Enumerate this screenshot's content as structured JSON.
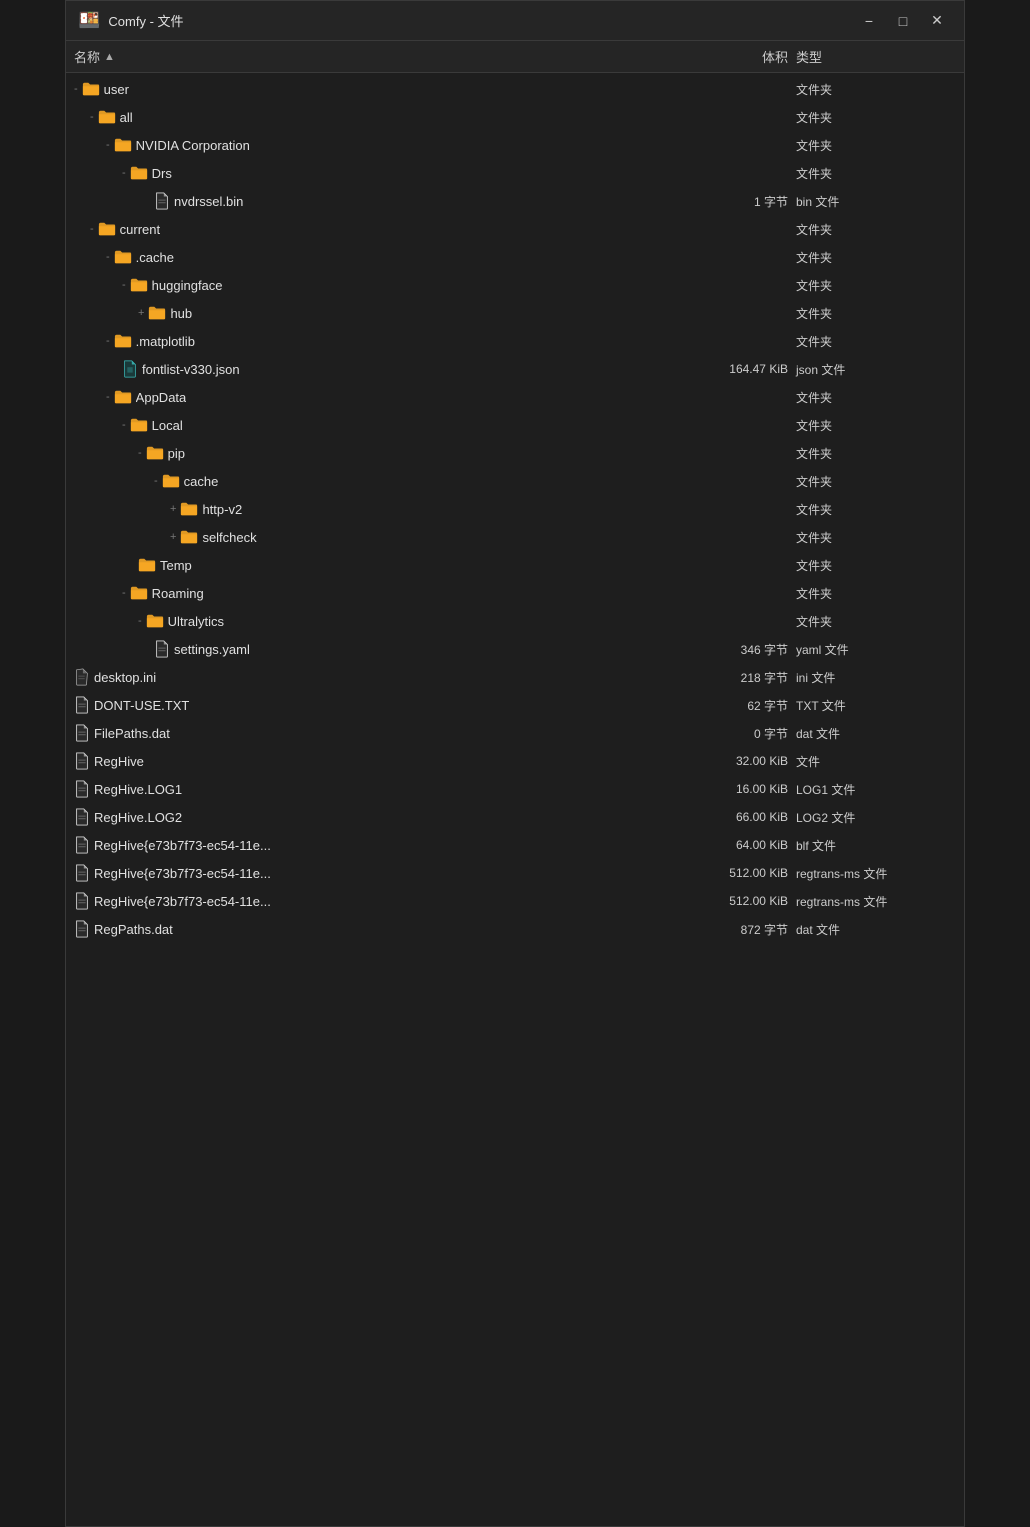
{
  "titlebar": {
    "icon": "🍱",
    "title": "Comfy - 文件",
    "minimize_label": "−",
    "maximize_label": "□",
    "close_label": "✕"
  },
  "header": {
    "name_label": "名称",
    "size_label": "体积",
    "type_label": "类型"
  },
  "files": [
    {
      "id": 1,
      "indent": 0,
      "prefix": "-",
      "type": "folder",
      "name": "user",
      "size": "",
      "filetype": "文件夹",
      "expand": ""
    },
    {
      "id": 2,
      "indent": 1,
      "prefix": "-",
      "type": "folder",
      "name": "all",
      "size": "",
      "filetype": "文件夹",
      "expand": ""
    },
    {
      "id": 3,
      "indent": 2,
      "prefix": "-",
      "type": "folder",
      "name": "NVIDIA Corporation",
      "size": "",
      "filetype": "文件夹",
      "expand": ""
    },
    {
      "id": 4,
      "indent": 3,
      "prefix": "-",
      "type": "folder",
      "name": "Drs",
      "size": "",
      "filetype": "文件夹",
      "expand": ""
    },
    {
      "id": 5,
      "indent": 5,
      "prefix": "",
      "type": "file-white",
      "name": "nvdrssel.bin",
      "size": "1 字节",
      "filetype": "bin 文件",
      "expand": ""
    },
    {
      "id": 6,
      "indent": 1,
      "prefix": "-",
      "type": "folder",
      "name": "current",
      "size": "",
      "filetype": "文件夹",
      "expand": ""
    },
    {
      "id": 7,
      "indent": 2,
      "prefix": "-",
      "type": "folder",
      "name": ".cache",
      "size": "",
      "filetype": "文件夹",
      "expand": ""
    },
    {
      "id": 8,
      "indent": 3,
      "prefix": "-",
      "type": "folder",
      "name": "huggingface",
      "size": "",
      "filetype": "文件夹",
      "expand": ""
    },
    {
      "id": 9,
      "indent": 4,
      "prefix": "+",
      "type": "folder",
      "name": "hub",
      "size": "",
      "filetype": "文件夹",
      "expand": ""
    },
    {
      "id": 10,
      "indent": 2,
      "prefix": "-",
      "type": "folder",
      "name": ".matplotlib",
      "size": "",
      "filetype": "文件夹",
      "expand": ""
    },
    {
      "id": 11,
      "indent": 3,
      "prefix": "",
      "type": "file-teal",
      "name": "fontlist-v330.json",
      "size": "164.47 KiB",
      "filetype": "json 文件",
      "expand": ""
    },
    {
      "id": 12,
      "indent": 2,
      "prefix": "-",
      "type": "folder",
      "name": "AppData",
      "size": "",
      "filetype": "文件夹",
      "expand": ""
    },
    {
      "id": 13,
      "indent": 3,
      "prefix": "-",
      "type": "folder",
      "name": "Local",
      "size": "",
      "filetype": "文件夹",
      "expand": ""
    },
    {
      "id": 14,
      "indent": 4,
      "prefix": "-",
      "type": "folder",
      "name": "pip",
      "size": "",
      "filetype": "文件夹",
      "expand": ""
    },
    {
      "id": 15,
      "indent": 5,
      "prefix": "-",
      "type": "folder",
      "name": "cache",
      "size": "",
      "filetype": "文件夹",
      "expand": ""
    },
    {
      "id": 16,
      "indent": 6,
      "prefix": "+",
      "type": "folder",
      "name": "http-v2",
      "size": "",
      "filetype": "文件夹",
      "expand": ""
    },
    {
      "id": 17,
      "indent": 6,
      "prefix": "+",
      "type": "folder",
      "name": "selfcheck",
      "size": "",
      "filetype": "文件夹",
      "expand": ""
    },
    {
      "id": 18,
      "indent": 4,
      "prefix": "",
      "type": "folder",
      "name": "Temp",
      "size": "",
      "filetype": "文件夹",
      "expand": ""
    },
    {
      "id": 19,
      "indent": 3,
      "prefix": "-",
      "type": "folder",
      "name": "Roaming",
      "size": "",
      "filetype": "文件夹",
      "expand": ""
    },
    {
      "id": 20,
      "indent": 4,
      "prefix": "-",
      "type": "folder",
      "name": "Ultralytics",
      "size": "",
      "filetype": "文件夹",
      "expand": ""
    },
    {
      "id": 21,
      "indent": 5,
      "prefix": "",
      "type": "file-white",
      "name": "settings.yaml",
      "size": "346 字节",
      "filetype": "yaml 文件",
      "expand": ""
    },
    {
      "id": 22,
      "indent": 0,
      "prefix": "",
      "type": "file-crumpled",
      "name": "desktop.ini",
      "size": "218 字节",
      "filetype": "ini 文件",
      "expand": ""
    },
    {
      "id": 23,
      "indent": 0,
      "prefix": "",
      "type": "file-white",
      "name": "DONT-USE.TXT",
      "size": "62 字节",
      "filetype": "TXT 文件",
      "expand": ""
    },
    {
      "id": 24,
      "indent": 0,
      "prefix": "",
      "type": "file-white",
      "name": "FilePaths.dat",
      "size": "0 字节",
      "filetype": "dat 文件",
      "expand": ""
    },
    {
      "id": 25,
      "indent": 0,
      "prefix": "",
      "type": "file-white",
      "name": "RegHive",
      "size": "32.00 KiB",
      "filetype": "文件",
      "expand": ""
    },
    {
      "id": 26,
      "indent": 0,
      "prefix": "",
      "type": "file-white",
      "name": "RegHive.LOG1",
      "size": "16.00 KiB",
      "filetype": "LOG1 文件",
      "expand": ""
    },
    {
      "id": 27,
      "indent": 0,
      "prefix": "",
      "type": "file-white",
      "name": "RegHive.LOG2",
      "size": "66.00 KiB",
      "filetype": "LOG2 文件",
      "expand": ""
    },
    {
      "id": 28,
      "indent": 0,
      "prefix": "",
      "type": "file-white",
      "name": "RegHive{e73b7f73-ec54-11e...",
      "size": "64.00 KiB",
      "filetype": "blf 文件",
      "expand": ""
    },
    {
      "id": 29,
      "indent": 0,
      "prefix": "",
      "type": "file-white",
      "name": "RegHive{e73b7f73-ec54-11e...",
      "size": "512.00 KiB",
      "filetype": "regtrans-ms 文件",
      "expand": ""
    },
    {
      "id": 30,
      "indent": 0,
      "prefix": "",
      "type": "file-white",
      "name": "RegHive{e73b7f73-ec54-11e...",
      "size": "512.00 KiB",
      "filetype": "regtrans-ms 文件",
      "expand": ""
    },
    {
      "id": 31,
      "indent": 0,
      "prefix": "",
      "type": "file-white",
      "name": "RegPaths.dat",
      "size": "872 字节",
      "filetype": "dat 文件",
      "expand": ""
    }
  ]
}
